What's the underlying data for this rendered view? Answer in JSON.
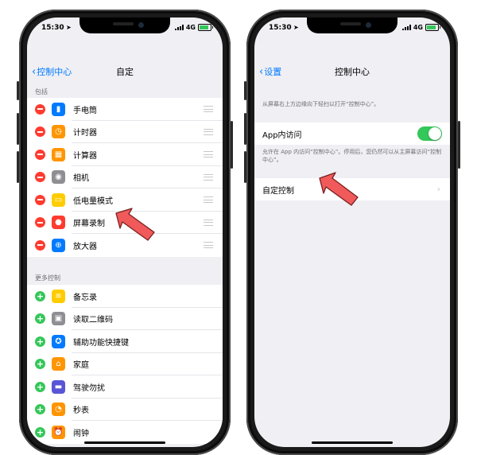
{
  "left_phone": {
    "status": {
      "time": "15:30",
      "network": "4G"
    },
    "nav": {
      "back_label": "控制中心",
      "title": "自定"
    },
    "included_header": "包括",
    "included": [
      {
        "label": "手电筒",
        "icon": "flashlight-icon",
        "color": "#007aff"
      },
      {
        "label": "计时器",
        "icon": "timer-icon",
        "color": "#ff9500"
      },
      {
        "label": "计算器",
        "icon": "calculator-icon",
        "color": "#ff9500"
      },
      {
        "label": "相机",
        "icon": "camera-icon",
        "color": "#8e8e93"
      },
      {
        "label": "低电量模式",
        "icon": "low-power-icon",
        "color": "#ffcc00"
      },
      {
        "label": "屏幕录制",
        "icon": "screen-record-icon",
        "color": "#ff3b30"
      },
      {
        "label": "放大器",
        "icon": "magnifier-icon",
        "color": "#007aff"
      }
    ],
    "more_header": "更多控制",
    "more": [
      {
        "label": "备忘录",
        "icon": "notes-icon",
        "color": "#ffcc00"
      },
      {
        "label": "读取二维码",
        "icon": "qr-code-icon",
        "color": "#8e8e93"
      },
      {
        "label": "辅助功能快捷键",
        "icon": "accessibility-icon",
        "color": "#007aff"
      },
      {
        "label": "家庭",
        "icon": "home-icon",
        "color": "#ff9500"
      },
      {
        "label": "驾驶勿扰",
        "icon": "car-icon",
        "color": "#5856d6"
      },
      {
        "label": "秒表",
        "icon": "stopwatch-icon",
        "color": "#ff9500"
      },
      {
        "label": "闹钟",
        "icon": "alarm-icon",
        "color": "#ff9500"
      }
    ]
  },
  "right_phone": {
    "status": {
      "time": "15:30",
      "network": "4G"
    },
    "nav": {
      "back_label": "设置",
      "title": "控制中心"
    },
    "intro_caption": "从屏幕右上方边缘向下轻扫以打开“控制中心”。",
    "in_app_access": {
      "label": "App内访问",
      "enabled": true
    },
    "in_app_caption": "允许在 App 内访问“控制中心”。停用后，您仍然可以从主屏幕访问“控制中心”。",
    "customize_label": "自定控制"
  },
  "colors": {
    "accent": "#007aff",
    "remove": "#ff3b30",
    "add": "#34c759",
    "pointer": "#f05a5a"
  }
}
